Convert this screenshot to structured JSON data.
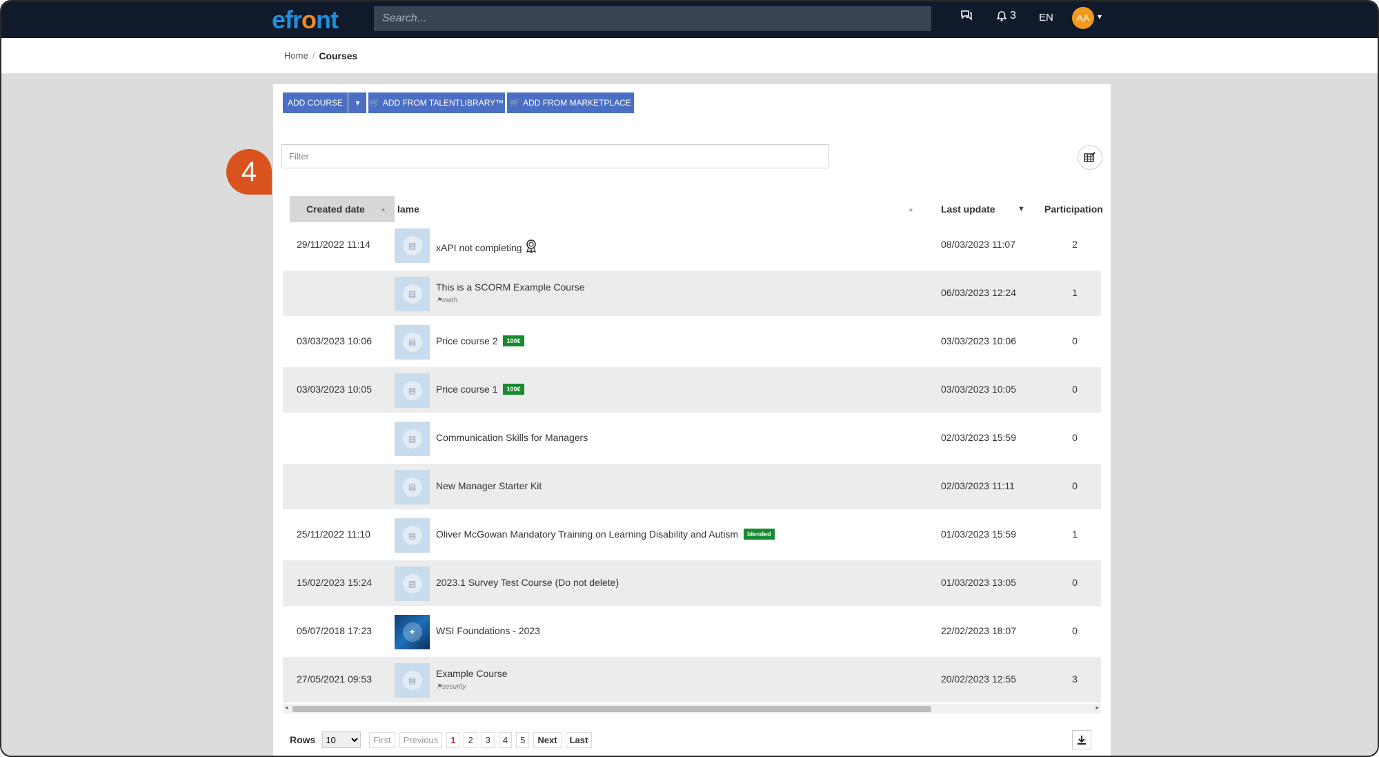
{
  "topbar": {
    "logo": {
      "pre": "efr",
      "o": "o",
      "post": "nt"
    },
    "search_placeholder": "Search...",
    "notifications_count": "3",
    "language": "EN",
    "avatar_initials": "AA"
  },
  "breadcrumb": {
    "home": "Home",
    "separator": "/",
    "current": "Courses"
  },
  "toolbar": {
    "add_course": "ADD COURSE",
    "add_talentlibrary": "ADD FROM TALENTLIBRARY™",
    "add_marketplace": "ADD FROM MARKETPLACE"
  },
  "filter_placeholder": "Filter",
  "table": {
    "headers": {
      "created": "Created date",
      "name": "lame",
      "last_update": "Last update",
      "participation": "Participation"
    },
    "rows": [
      {
        "created": "29/11/2022 11:14",
        "name": "xAPI not completing",
        "tag": "",
        "badge": "",
        "last_update": "08/03/2023 11:07",
        "participation": "2"
      },
      {
        "created": "",
        "name": "This is a SCORM Example Course",
        "tag": "math",
        "badge": "",
        "last_update": "06/03/2023 12:24",
        "participation": "1"
      },
      {
        "created": "03/03/2023 10:06",
        "name": "Price course 2",
        "tag": "",
        "badge": "100€",
        "last_update": "03/03/2023 10:06",
        "participation": "0"
      },
      {
        "created": "03/03/2023 10:05",
        "name": "Price course 1",
        "tag": "",
        "badge": "100€",
        "last_update": "03/03/2023 10:05",
        "participation": "0"
      },
      {
        "created": "",
        "name": "Communication Skills for Managers",
        "tag": "",
        "badge": "",
        "last_update": "02/03/2023 15:59",
        "participation": "0"
      },
      {
        "created": "",
        "name": "New Manager Starter Kit",
        "tag": "",
        "badge": "",
        "last_update": "02/03/2023 11:11",
        "participation": "0"
      },
      {
        "created": "25/11/2022 11:10",
        "name": "Oliver McGowan Mandatory Training on Learning Disability and Autism",
        "tag": "",
        "badge": "blended",
        "last_update": "01/03/2023 15:59",
        "participation": "1"
      },
      {
        "created": "15/02/2023 15:24",
        "name": "2023.1 Survey Test Course (Do not delete)",
        "tag": "",
        "badge": "",
        "last_update": "01/03/2023 13:05",
        "participation": "0"
      },
      {
        "created": "05/07/2018 17:23",
        "name": "WSI Foundations - 2023",
        "tag": "",
        "badge": "",
        "last_update": "22/02/2023 18:07",
        "participation": "0"
      },
      {
        "created": "27/05/2021 09:53",
        "name": "Example Course",
        "tag": "security",
        "badge": "",
        "last_update": "20/02/2023 12:55",
        "participation": "3"
      }
    ]
  },
  "pagination": {
    "rows_label": "Rows",
    "rows_value": "10",
    "first": "First",
    "previous": "Previous",
    "pages": [
      "1",
      "2",
      "3",
      "4",
      "5"
    ],
    "next": "Next",
    "last": "Last"
  },
  "callout_number": "4",
  "colors": {
    "accent": "#4a6fc4",
    "callout": "#d9531e",
    "badge": "#168a2e",
    "topbar": "#0f1b2a"
  }
}
